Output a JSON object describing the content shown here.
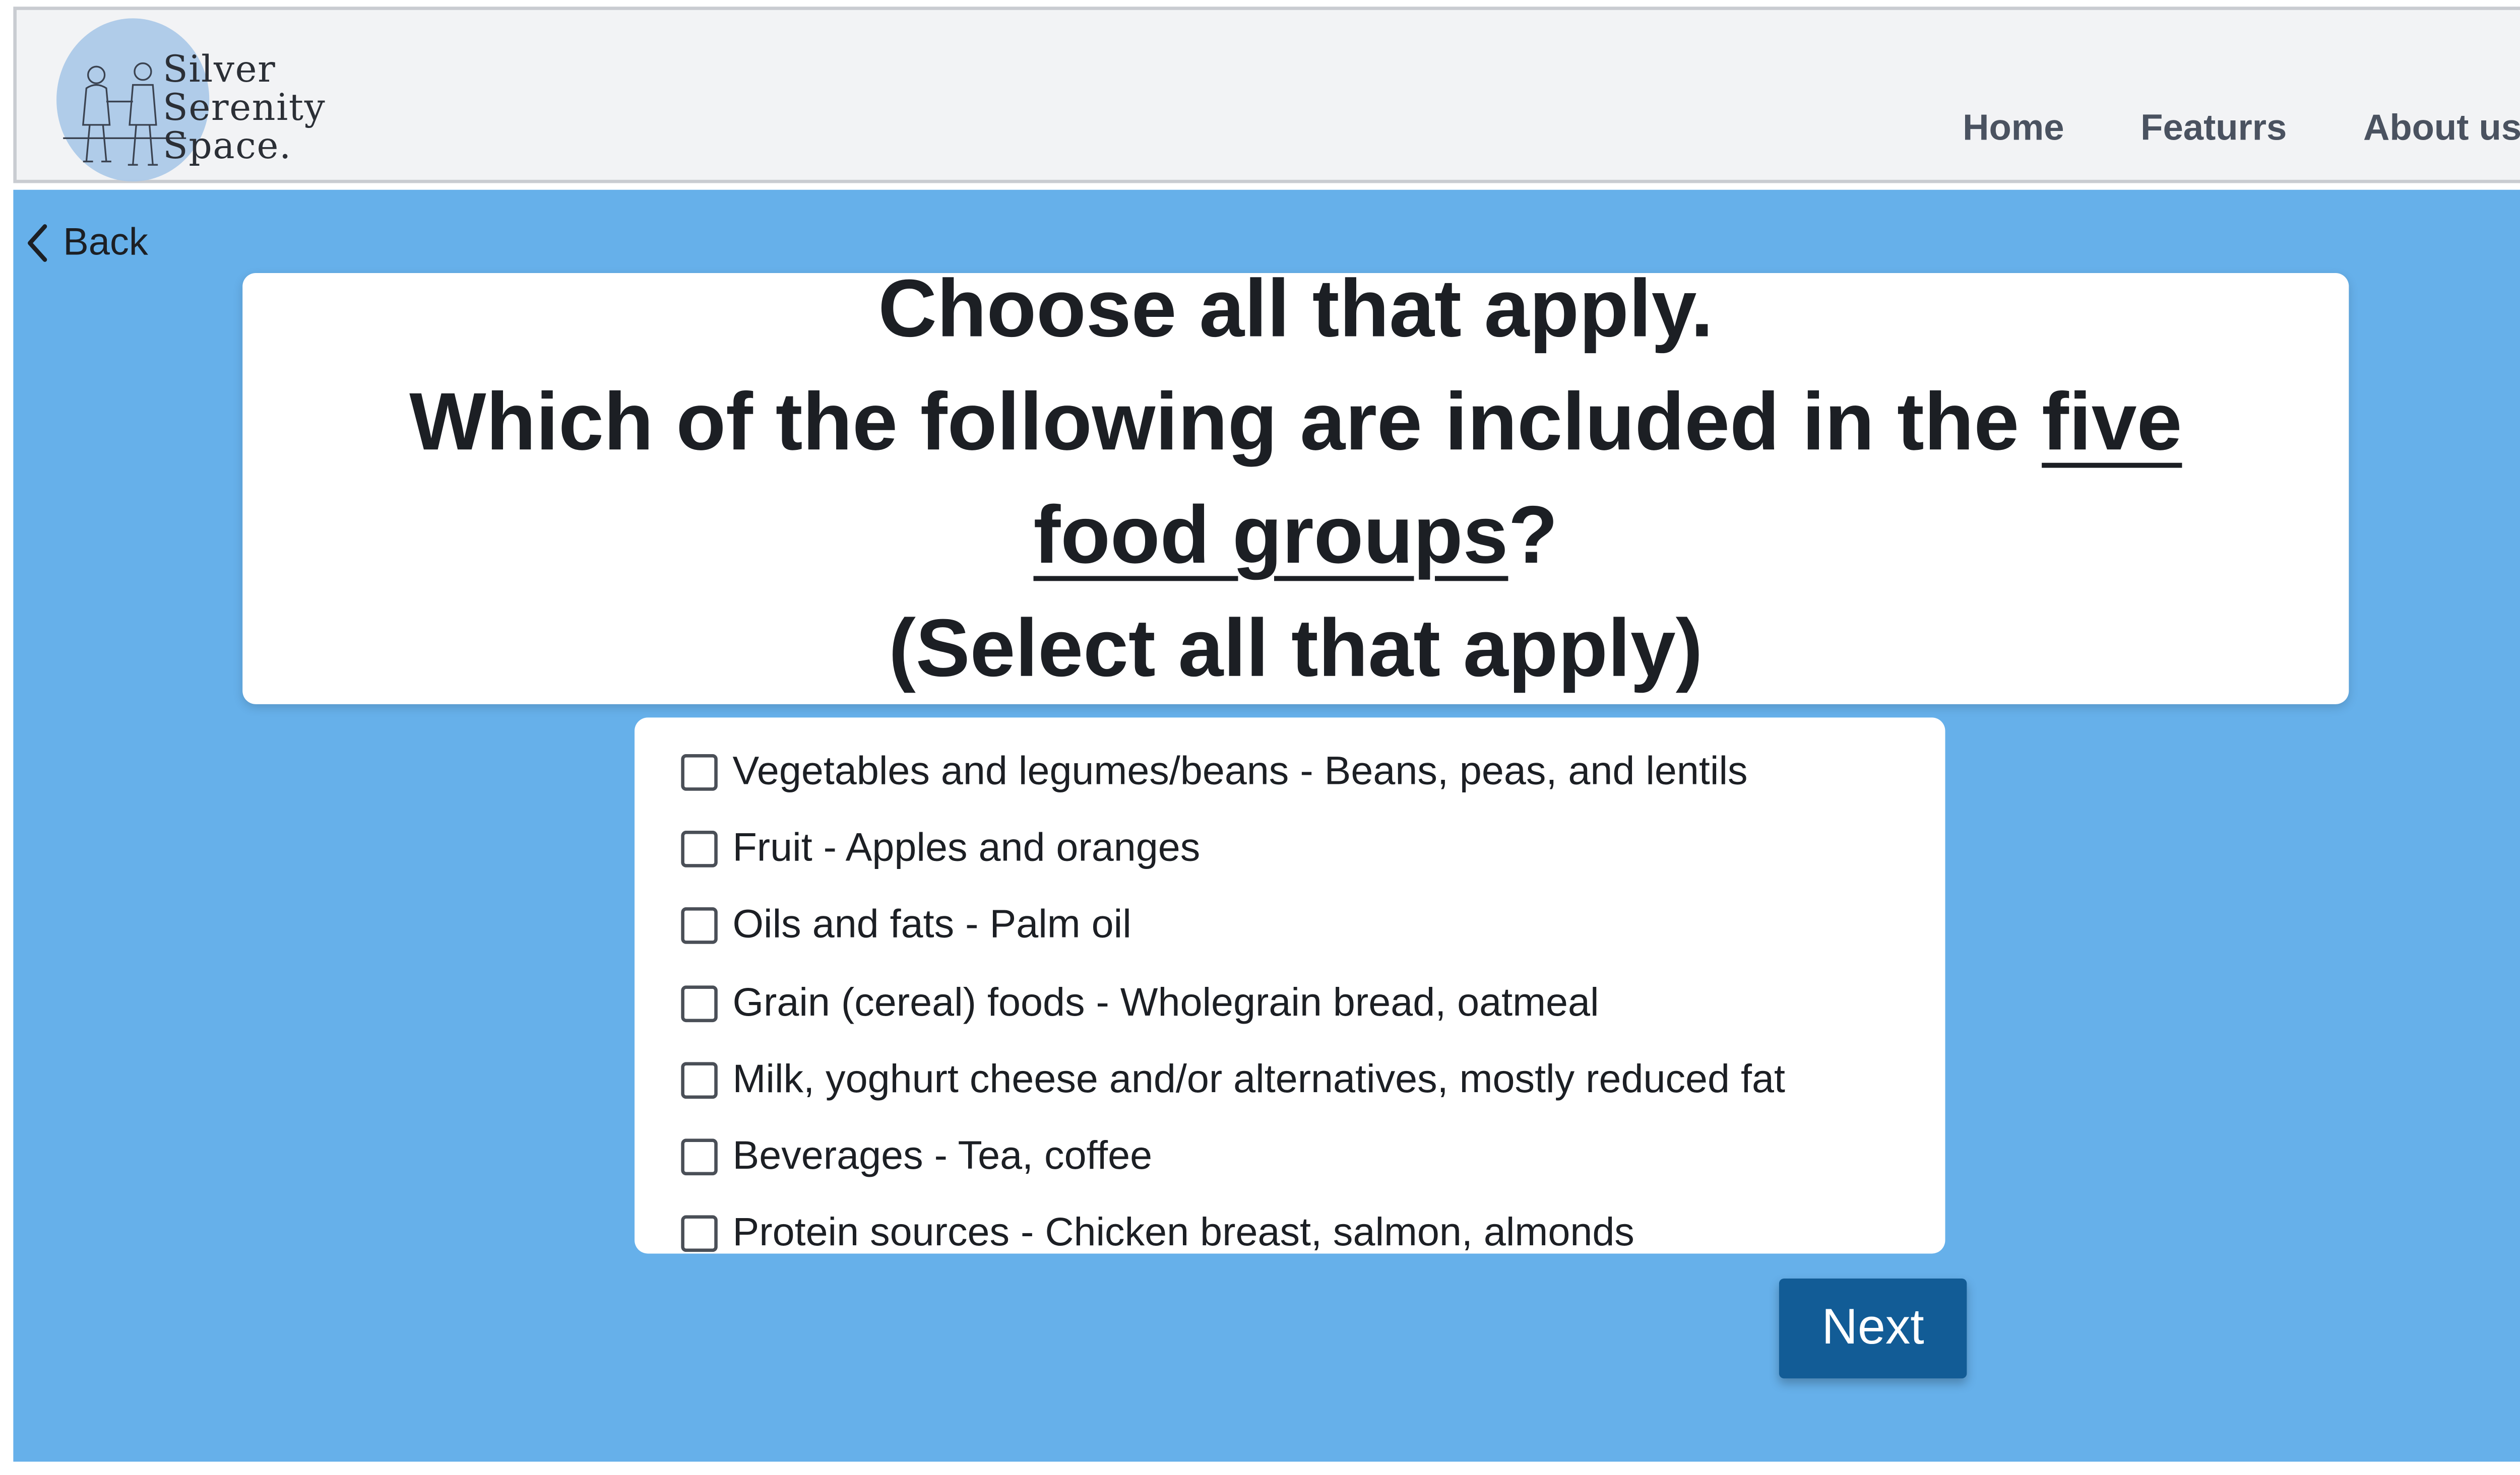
{
  "header": {
    "logo_lines": [
      "Silver",
      "Serenity",
      "Space."
    ],
    "nav": [
      {
        "label": "Home"
      },
      {
        "label": "Featurrs"
      },
      {
        "label": "About us"
      }
    ]
  },
  "back_label": "Back",
  "question": {
    "line1": "Choose all that apply.",
    "line2_prefix": "Which of the following are included in the ",
    "line2_underlined": "five",
    "line3_underlined": "food groups",
    "line3_suffix": "?",
    "line4": "(Select all that apply)"
  },
  "options": [
    {
      "label": "Vegetables and legumes/beans - Beans, peas, and lentils",
      "checked": false
    },
    {
      "label": "Fruit - Apples and oranges",
      "checked": false
    },
    {
      "label": "Oils and fats - Palm oil",
      "checked": false
    },
    {
      "label": "Grain (cereal) foods - Wholegrain bread, oatmeal",
      "checked": false
    },
    {
      "label": "Milk, yoghurt cheese and/or alternatives, mostly reduced fat",
      "checked": false
    },
    {
      "label": "Beverages - Tea, coffee",
      "checked": false
    },
    {
      "label": "Protein sources - Chicken breast, salmon, almonds",
      "checked": false
    }
  ],
  "next_label": "Next",
  "colors": {
    "background": "#66b0ea",
    "next_button": "#125c96",
    "header_bg": "#f2f3f5"
  },
  "icons": {
    "back": "chevron-left-icon",
    "logo": "elderly-couple-logo-icon"
  }
}
